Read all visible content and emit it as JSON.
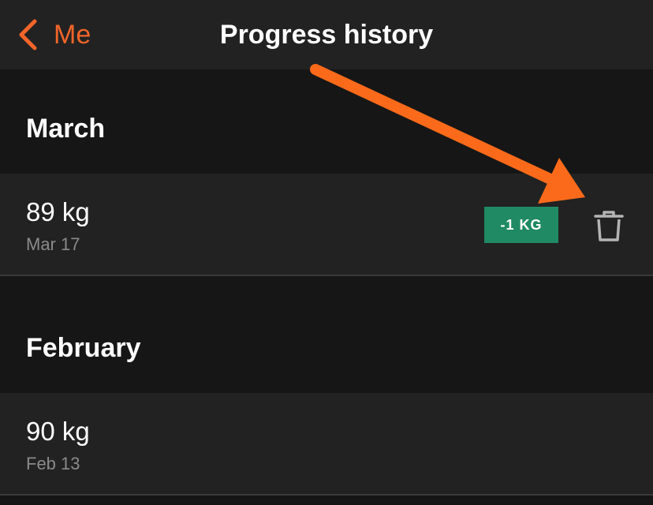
{
  "nav": {
    "back_label": "Me",
    "title": "Progress history"
  },
  "sections": [
    {
      "title": "March",
      "entries": [
        {
          "weight": "89 kg",
          "date": "Mar 17",
          "change": "-1 KG",
          "change_color": "#1f8a63"
        }
      ]
    },
    {
      "title": "February",
      "entries": [
        {
          "weight": "90 kg",
          "date": "Feb 13"
        }
      ]
    }
  ],
  "colors": {
    "accent": "#f2652a",
    "background": "#161616",
    "row_background": "#222222",
    "badge": "#1f8a63",
    "annotation_arrow": "#fb6a1a"
  },
  "icons": {
    "back": "chevron-left-icon",
    "delete": "trash-icon",
    "annotation": "arrow-annotation-icon"
  }
}
